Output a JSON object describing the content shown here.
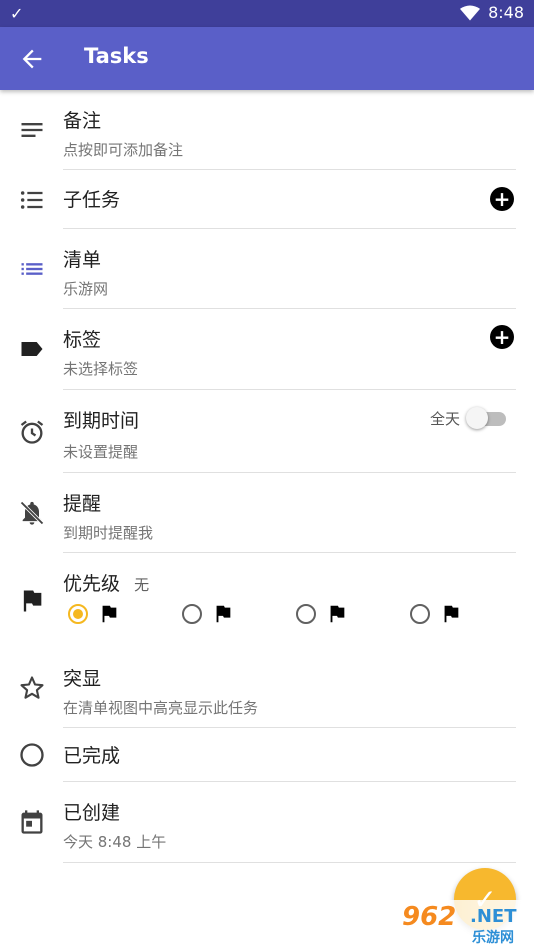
{
  "status_bar": {
    "time": "8:48"
  },
  "app_bar": {
    "title": "Tasks"
  },
  "rows": {
    "notes": {
      "title": "备注",
      "subtitle": "点按即可添加备注"
    },
    "subtasks": {
      "title": "子任务"
    },
    "list": {
      "title": "清单",
      "subtitle": "乐游网"
    },
    "tags": {
      "title": "标签",
      "subtitle": "未选择标签"
    },
    "due": {
      "title": "到期时间",
      "subtitle": "未设置提醒",
      "all_day_label": "全天",
      "all_day_on": false
    },
    "reminder": {
      "title": "提醒",
      "subtitle": "到期时提醒我"
    },
    "priority": {
      "title": "优先级",
      "value": "无",
      "selected_index": 0
    },
    "starred": {
      "title": "突显",
      "subtitle": "在清单视图中高亮显示此任务"
    },
    "completed": {
      "title": "已完成"
    },
    "created": {
      "title": "已创建",
      "subtitle": "今天 8:48 上午"
    }
  },
  "watermark": {
    "number": "962",
    "domain": ".NET",
    "name": "乐游网"
  },
  "colors": {
    "app_bar": "#5a5fc8",
    "status_bar": "#3f3f9a",
    "accent": "#f5b820",
    "list_icon": "#5a5fc8"
  }
}
